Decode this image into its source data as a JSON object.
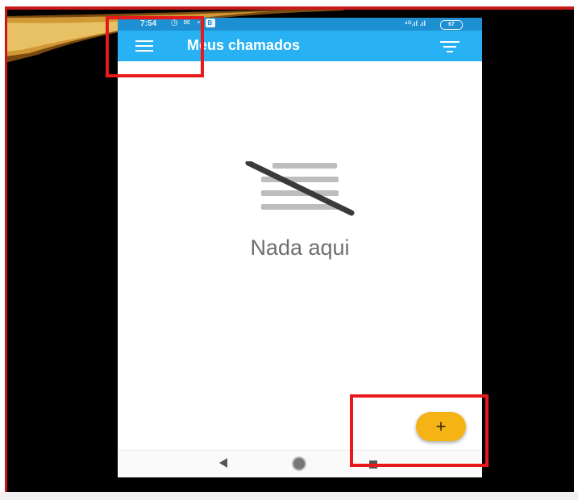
{
  "status_bar": {
    "time": "7:54",
    "left_icons": "◷ ✉ ◔",
    "badge": "B",
    "signal": "⁴ᴳ.ıl .ıl",
    "battery": "67"
  },
  "app_bar": {
    "title": "Meus chamados",
    "menu_icon": "hamburger-menu-icon",
    "filter_icon": "filter-icon"
  },
  "empty_state": {
    "icon": "no-content-icon",
    "text": "Nada aqui"
  },
  "fab": {
    "label": "+",
    "icon": "add-icon",
    "color": "#f5b316"
  },
  "nav_bar": {
    "back_icon": "back-icon",
    "home_icon": "home-icon",
    "recents_icon": "recents-icon"
  },
  "colors": {
    "app_bar": "#29b2f3",
    "status_bar": "#1e8fd1",
    "highlight": "#e8191a",
    "slide_background": "#000000"
  }
}
